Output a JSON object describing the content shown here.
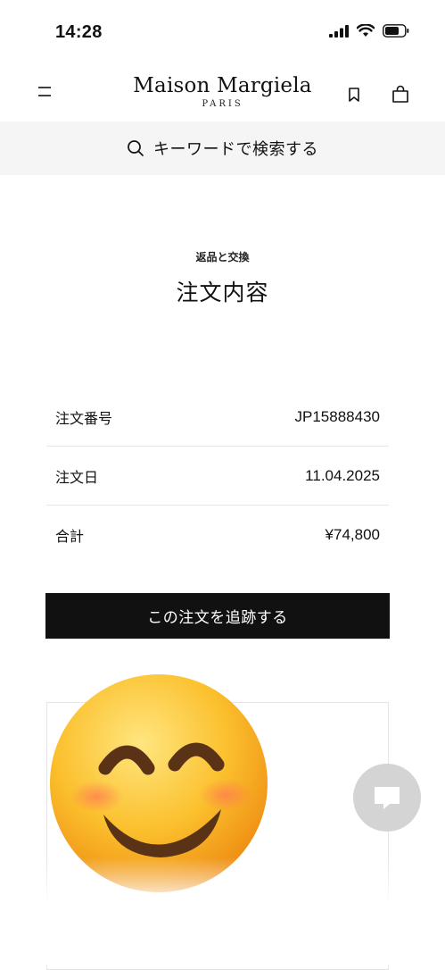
{
  "status_bar": {
    "time": "14:28"
  },
  "header": {
    "brand": "Maison Margiela",
    "brand_sub": "PARIS"
  },
  "search": {
    "text": "キーワードで検索する"
  },
  "page": {
    "section_label": "返品と交換",
    "title": "注文内容"
  },
  "order": {
    "rows": [
      {
        "label": "注文番号",
        "value": "JP15888430"
      },
      {
        "label": "注文日",
        "value": "11.04.2025"
      },
      {
        "label": "合計",
        "value": "¥74,800"
      }
    ]
  },
  "actions": {
    "track_label": "この注文を追跡する"
  },
  "icons": [
    "menu-icon",
    "bookmark-icon",
    "shopping-bag-icon",
    "search-icon",
    "chat-icon",
    "smiling-face-emoji"
  ],
  "colors": {
    "button": "#111111",
    "search_bg": "#f5f5f5",
    "chat_bg": "#d4d4d4"
  }
}
